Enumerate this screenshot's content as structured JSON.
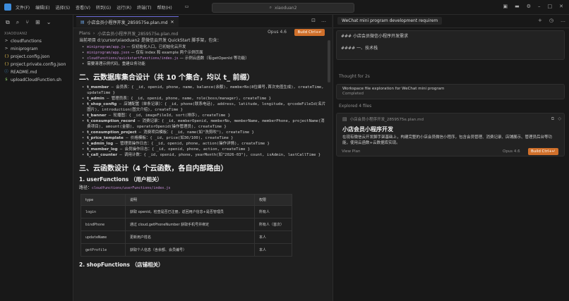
{
  "titlebar": {
    "menu": [
      "文件(F)",
      "编辑(E)",
      "选择(S)",
      "查看(V)",
      "转到(G)",
      "运行(R)",
      "终端(T)",
      "帮助(H)"
    ],
    "search": "xiaoduan2"
  },
  "sidebar": {
    "root": "XIAODUAN2",
    "items": [
      {
        "icon": ">",
        "label": "cloudfunctions"
      },
      {
        "icon": ">",
        "label": "miniprogram"
      },
      {
        "icon": "{}",
        "label": "project.config.json"
      },
      {
        "icon": "{}",
        "label": "project.private.config.json"
      },
      {
        "icon": "ⓘ",
        "label": "README.md"
      },
      {
        "icon": "$",
        "label": "uploadCloudFunction.sh"
      }
    ]
  },
  "editor": {
    "tab": "小店会员小程序开发_2859575e.plan.md",
    "crumb": [
      "Plans",
      "小店会员小程序开发_2859575e.plan.md"
    ],
    "model": "Opus 4.6",
    "build": "Build Ctrl+↵",
    "intro_prefix": "当前项目 d:\\cursor\\xiaoduan2 是微信云开发 QuickStart 脚手架，包含：",
    "intro_bullets": [
      {
        "code": "miniprogram/app.js",
        "text": " — 仅初始化入口，已初始化云开发"
      },
      {
        "code": "miniprogram/app.json",
        "text": " — 仅有 index 和 example 两个示例页面"
      },
      {
        "code": "cloudfunctions/quickstartFunctions/index.js",
        "text": " — 示例云函数（有getOpenId 等功能）"
      },
      {
        "code": "",
        "text": "需要清理示例代码，重建业务功能"
      }
    ],
    "h_collections": "二、云数据库集合设计（共 10 个集合，均以 t_ 前缀）",
    "collections": [
      {
        "name": "t_member",
        "text": " — 会员表：{ _id, openid, phone, name, balance(余额), memberNo(8位编号,首次充值生成), createTime, updateTime }"
      },
      {
        "name": "t_admin",
        "text": " — 管理员表：{ _id, openid, phone, name, role(boss/manager), createTime }"
      },
      {
        "name": "t_shop_config",
        "text": " — 店铺配置（单条记录）：{ _id, phone(联系电话), address, latitude, longitude, qrcodeFileId(名片图片), introduction(图文介绍), createTime }"
      },
      {
        "name": "t_banner",
        "text": " — 轮播图：{ _id, imageFileId, sort(排序), createTime }"
      },
      {
        "name": "t_consumption_record",
        "text": " — 消费记录：{ _id, memberOpenid, memberNo, memberName, memberPhone, projectName(消费项目), amount(金额), operatorOpenid(操作管理员), createTime }"
      },
      {
        "name": "t_consumption_project",
        "text": " — 消费项目模板：{ _id, name(如\"洗剪吹\"), createTime }"
      },
      {
        "name": "t_price_template",
        "text": " — 价格模板：{ _id, price(如30/100), createTime }"
      },
      {
        "name": "t_admin_log",
        "text": " — 管理员操作日志：{ _id, openid, phone, action(操作详情), createTime }"
      },
      {
        "name": "t_member_log",
        "text": " — 会员操作日志：{ _id, openid, phone, action, createTime }"
      },
      {
        "name": "t_call_counter",
        "text": " — 调用计数：{ _id, openid, phone, yearMonth(如\"2026-03\"), count, isAdmin, lastCallTime }"
      }
    ],
    "h_functions": "三、云函数设计（4 个云函数，各自内部路由）",
    "h_user": "1. userFunctions （用户相关）",
    "path_label": "路径：",
    "path_code": "cloudfunctions/userFunctions/index.js",
    "table_headers": [
      "type",
      "说明",
      "权限"
    ],
    "table_rows": [
      [
        "login",
        "获取 openid，检查是否已注册，返回用户信息+是否管理员",
        "所有人"
      ],
      [
        "bindPhone",
        "通过 cloud.getPhoneNumber 获取手机号并绑定",
        "所有人（首次）"
      ],
      [
        "updateName",
        "更新用户姓名",
        "本人"
      ],
      [
        "getProfile",
        "获取个人信息（含余额、会员编号）",
        "本人"
      ]
    ],
    "h_shop": "2. shopFunctions （店铺相关）"
  },
  "chat": {
    "title": "WeChat mini program development requirem",
    "msg1": "### 小店会员微信小程序开发需求",
    "msg2": "#### 一、技术栈",
    "thought": "Thought for 2s",
    "exploration_title": "Workspace file exploration for WeChat mini program",
    "exploration_status": "Completed",
    "explored": "Explored 4 files",
    "plan_file": "小店会员小程序开发_2859575e.plan.md",
    "plan_title": "小店会员小程序开发",
    "plan_desc": "在现有微信云开发脚手架基础上，构建完整的小店会员微信小程序，包含会员管理、消费记录、店铺展示、管理员后台等功能，使用云函数+云数据库实现。",
    "view_plan": "View Plan",
    "model": "Opus 4.6",
    "build": "Build Ctrl+↵"
  }
}
